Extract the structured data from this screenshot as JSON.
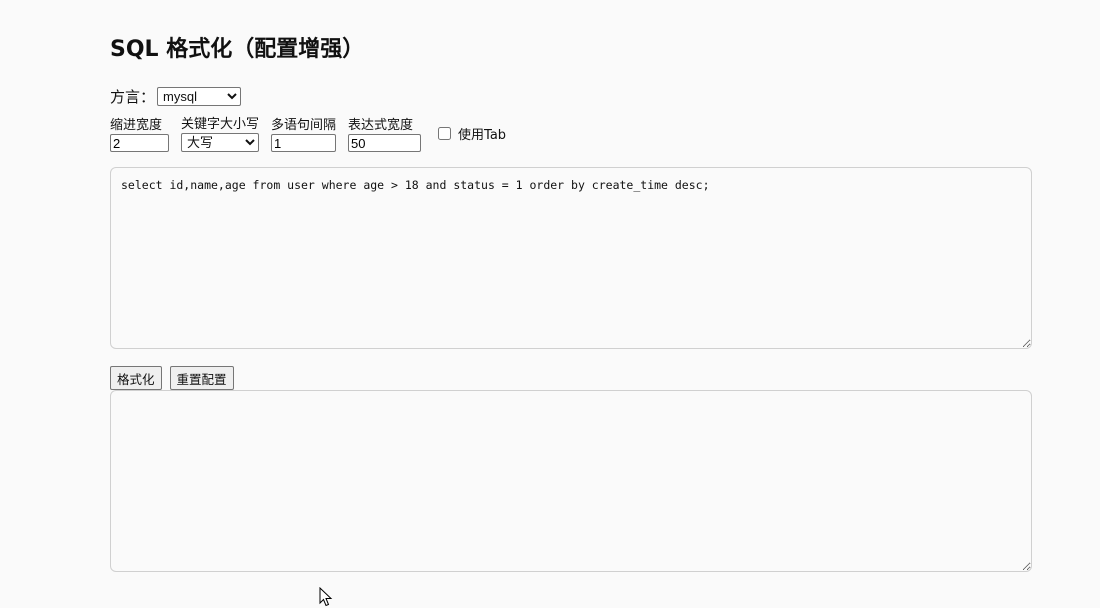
{
  "page": {
    "title": "SQL 格式化（配置增强）"
  },
  "dialect": {
    "label": "方言：",
    "selected": "mysql"
  },
  "options": {
    "indent": {
      "label": "缩进宽度",
      "value": "2"
    },
    "keyword_case": {
      "label": "关键字大小写",
      "selected": "大写"
    },
    "lines_between": {
      "label": "多语句间隔",
      "value": "1"
    },
    "expr_width": {
      "label": "表达式宽度",
      "value": "50"
    },
    "use_tab": {
      "label": "使用Tab",
      "checked": false
    }
  },
  "input": {
    "sql": "select id,name,age from user where age > 18 and status = 1 order by create_time desc;"
  },
  "buttons": {
    "format": "格式化",
    "reset": "重置配置"
  },
  "output": {
    "sql": ""
  }
}
